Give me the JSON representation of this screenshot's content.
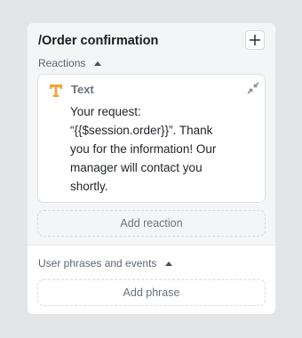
{
  "card": {
    "title": "/Order confirmation",
    "add_icon": "plus-icon"
  },
  "reactions": {
    "header": "Reactions",
    "caret_icon": "caret-up-icon",
    "items": [
      {
        "type_icon": "text-t-icon",
        "type_label": "Text",
        "action_icon": "collapse-arrows-icon",
        "message": "Your request:\n“{{$session.order}}”. Thank you for the information! Our manager will contact you shortly."
      }
    ],
    "add_label": "Add reaction"
  },
  "phrases": {
    "header": "User phrases and events",
    "caret_icon": "caret-up-icon",
    "add_label": "Add phrase"
  },
  "colors": {
    "accent_icon": "#f2a33a",
    "card_bg": "#f4f5f6",
    "page_bg": "#e4e5e7"
  }
}
